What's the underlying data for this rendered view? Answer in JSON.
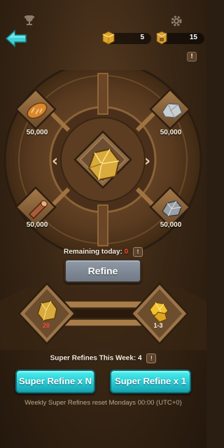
{
  "header": {
    "currency_1": {
      "icon": "gold-cube-icon",
      "value": "5"
    },
    "currency_2": {
      "icon": "refined-gold-icon",
      "value": "15"
    },
    "info": "!"
  },
  "wheel": {
    "resources": [
      {
        "name": "bread",
        "icon": "bread-icon",
        "amount": "50,000"
      },
      {
        "name": "stone",
        "icon": "stone-icon",
        "amount": "50,000"
      },
      {
        "name": "wood",
        "icon": "wood-log-icon",
        "amount": "50,000"
      },
      {
        "name": "iron",
        "icon": "iron-ore-icon",
        "amount": "50,000"
      }
    ],
    "center_item": "gold-ore-icon"
  },
  "refine": {
    "remaining_label": "Remaining today:",
    "remaining_value": "0",
    "info": "!",
    "button_label": "Refine"
  },
  "super": {
    "input_count": "20",
    "output_count": "1-3",
    "week_label": "Super Refines This Week:",
    "week_value": "4",
    "info": "!",
    "button_n_label": "Super Refine x N",
    "button_1_label": "Super Refine x 1",
    "reset_note": "Weekly Super Refines reset Mondays 00:00 (UTC+0)"
  },
  "colors": {
    "accent_teal": "#29c9d2",
    "warning_red": "#ff4a3a",
    "gold": "#e8b93a"
  }
}
